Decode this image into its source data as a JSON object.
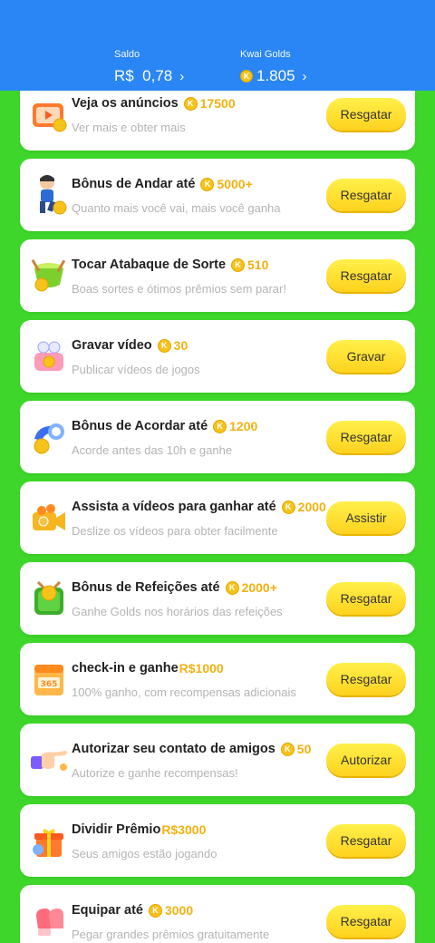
{
  "header": {
    "saldo_label": "Saldo",
    "saldo_value": "R$  0,78",
    "golds_label": "Kwai Golds",
    "golds_value": "1.805",
    "chevron": "›",
    "coin_glyph": "K"
  },
  "tasks": [
    {
      "title": "Veja os anúncios",
      "reward": "17500",
      "reward_type": "coin",
      "subtitle": "Ver mais e obter mais",
      "button": "Resgatar",
      "icon": "tv-ad-icon"
    },
    {
      "title": "Bônus de Andar até",
      "reward": "5000+",
      "reward_type": "coin",
      "subtitle": "Quanto mais você vai, mais você ganha",
      "button": "Resgatar",
      "icon": "walking-boy-icon"
    },
    {
      "title": "Tocar Atabaque de Sorte",
      "reward": "510",
      "reward_type": "coin",
      "subtitle": "Boas sortes e ótimos prêmios sem parar!",
      "button": "Resgatar",
      "icon": "drum-icon"
    },
    {
      "title": "Gravar vídeo",
      "reward": "30",
      "reward_type": "coin",
      "subtitle": "Publicar vídeos de jogos",
      "button": "Gravar",
      "icon": "video-record-icon"
    },
    {
      "title": "Bônus de Acordar até",
      "reward": "1200",
      "reward_type": "coin",
      "subtitle": "Acorde antes das 10h e ganhe",
      "button": "Resgatar",
      "icon": "alarm-icon"
    },
    {
      "title": "Assista a vídeos para ganhar até",
      "reward": "2000",
      "reward_type": "coin",
      "subtitle": "Deslize os vídeos para obter facilmente",
      "button": "Assistir",
      "icon": "camera-icon"
    },
    {
      "title": "Bônus de Refeições até",
      "reward": "2000+",
      "reward_type": "coin",
      "subtitle": "Ganhe Golds nos horários das refeições",
      "button": "Resgatar",
      "icon": "meal-box-icon"
    },
    {
      "title": "check-in e ganhe",
      "reward": "R$1000",
      "reward_type": "money",
      "subtitle": "100% ganho, com recompensas adicionais",
      "button": "Resgatar",
      "icon": "calendar-icon"
    },
    {
      "title": "Autorizar seu contato de amigos",
      "reward": "50",
      "reward_type": "coin",
      "subtitle": "Autorize e ganhe recompensas!",
      "button": "Autorizar",
      "icon": "hand-point-icon"
    },
    {
      "title": "Dividir Prêmio",
      "reward": "R$3000",
      "reward_type": "money",
      "subtitle": "Seus amigos estão jogando",
      "button": "Resgatar",
      "icon": "gift-box-icon"
    },
    {
      "title": "Equipar até",
      "reward": "3000",
      "reward_type": "coin",
      "subtitle": "Pegar grandes prêmios gratuitamente",
      "button": "Resgatar",
      "icon": "boxing-glove-icon"
    }
  ],
  "colors": {
    "header_blue": "#2a86f4",
    "frame_green": "#3ed62a",
    "reward_gold": "#f3b111",
    "button_yellow": "#ffe136"
  }
}
